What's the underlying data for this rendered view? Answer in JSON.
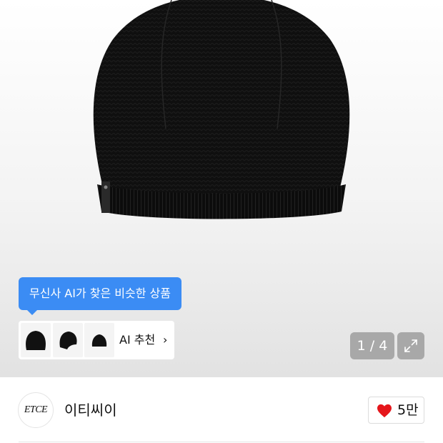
{
  "product_image": {
    "alt_icon": "beanie-image",
    "page_counter": "1 / 4"
  },
  "ai_recommend": {
    "tooltip": "무신사 AI가 찾은 비슷한 상품",
    "label": "AI 추천",
    "chevron": "›",
    "thumbnails": [
      "beanie-thumb-1",
      "beanie-thumb-2",
      "beanie-thumb-3"
    ],
    "accent": "#3b8cf4"
  },
  "brand": {
    "logo_text": "ETCE",
    "name": "이티씨이"
  },
  "like": {
    "count": "5만",
    "icon": "heart-icon",
    "color": "#e5161b"
  }
}
